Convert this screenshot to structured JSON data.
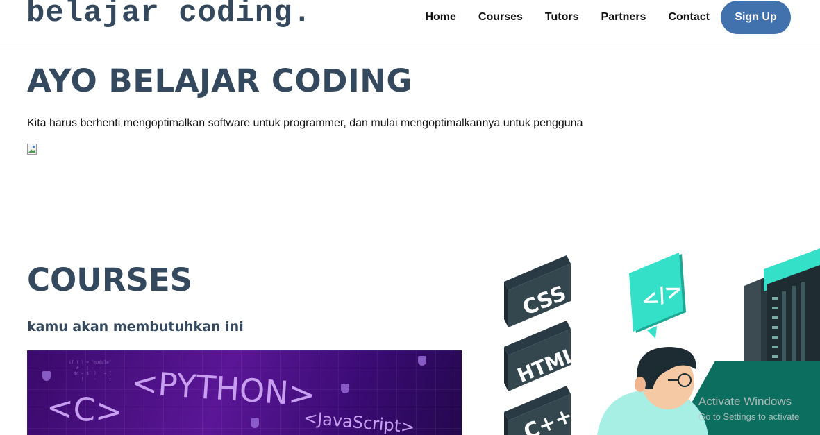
{
  "header": {
    "brand": "belajar coding.",
    "nav": [
      {
        "label": "Home"
      },
      {
        "label": "Courses"
      },
      {
        "label": "Tutors"
      },
      {
        "label": "Partners"
      },
      {
        "label": "Contact"
      }
    ],
    "signup_label": "Sign Up"
  },
  "hero": {
    "title": "AYO BELAJAR CODING",
    "subtitle": "Kita harus berhenti mengoptimalkan software untuk programmer, dan mulai mengoptimalkannya untuk pengguna"
  },
  "courses": {
    "title": "COURSES",
    "subtitle": "kamu akan membutuhkan ini",
    "banner": {
      "python": "<PYTHON>",
      "c": "<C>",
      "javascript": "<JavaScript>"
    }
  },
  "illustration": {
    "css": "CSS",
    "html": "HTML",
    "cpp": "C++",
    "code_tag": "</>"
  },
  "watermark": {
    "title": "Activate Windows",
    "subtitle": "Go to Settings to activate"
  },
  "colors": {
    "brand": "#34495e",
    "accent": "#4272ad",
    "teal": "#2ed6c2"
  }
}
